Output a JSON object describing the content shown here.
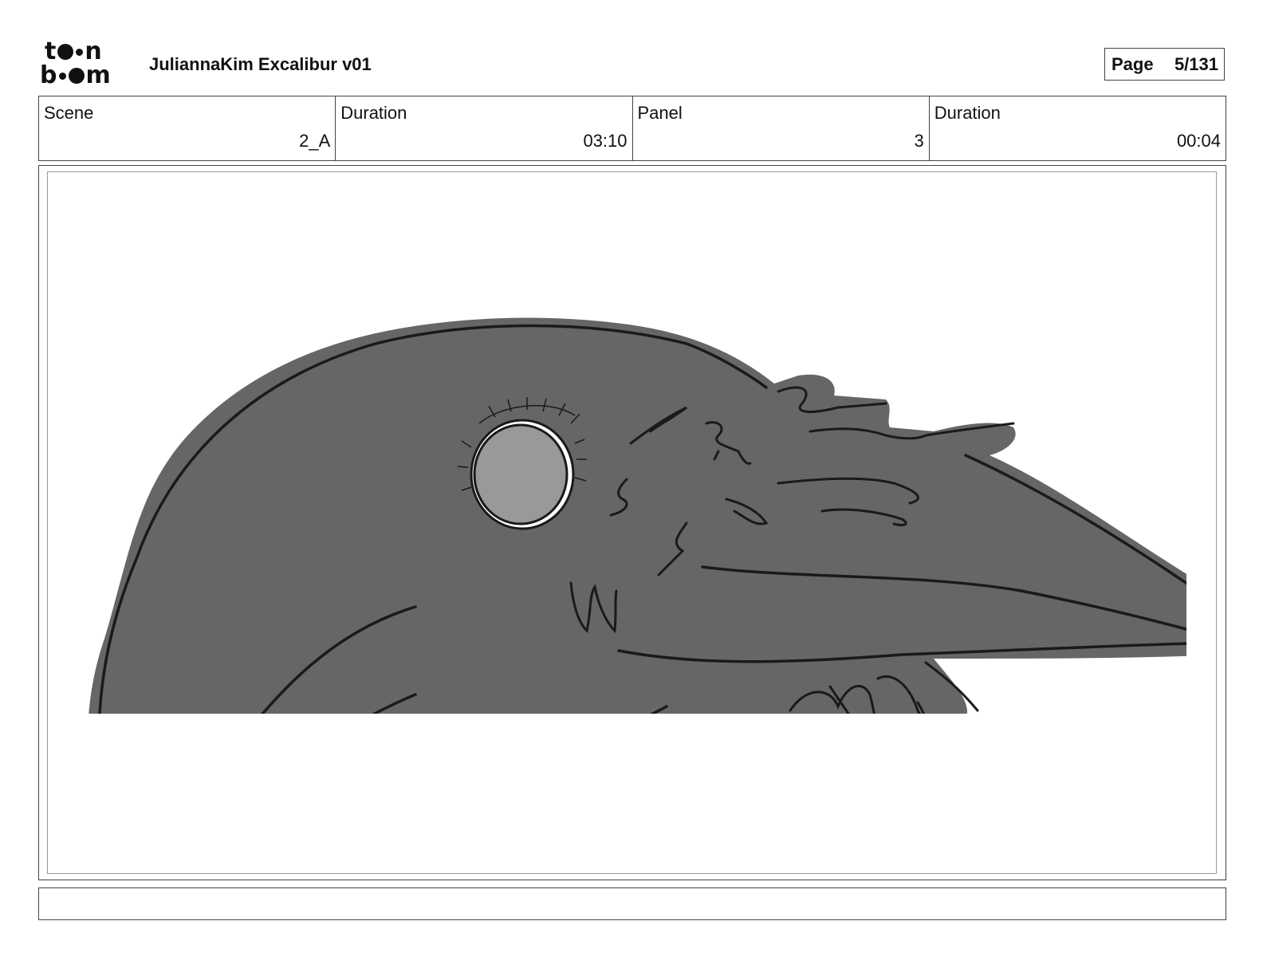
{
  "header": {
    "logo_text_top": "toon",
    "logo_text_bottom": "boom",
    "title": "JuliannaKim Excalibur v01",
    "page_label": "Page",
    "page_value": "5/131"
  },
  "info": {
    "scene_label": "Scene",
    "scene_value": "2_A",
    "scene_duration_label": "Duration",
    "scene_duration_value": "03:10",
    "panel_label": "Panel",
    "panel_value": "3",
    "panel_duration_label": "Duration",
    "panel_duration_value": "00:04"
  },
  "panel": {
    "image_icon": "raven-sketch",
    "fill_color": "#666666",
    "eye_color": "#999999",
    "line_color": "#1a1a1a"
  },
  "caption": {
    "text": ""
  }
}
